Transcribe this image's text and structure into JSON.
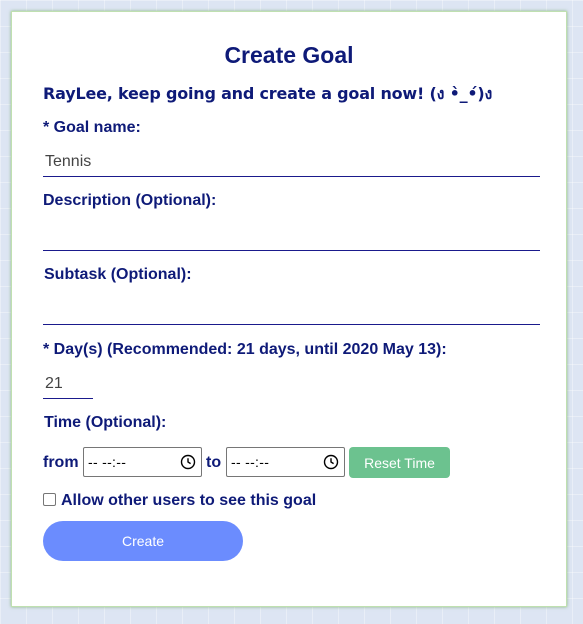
{
  "form": {
    "title": "Create Goal",
    "encouragement": "RayLee, keep going and create a goal now! (ง •̀_•́)ง",
    "goal_name_label": "* Goal name:",
    "goal_name_value": "Tennis",
    "description_label": "Description (Optional):",
    "description_value": "",
    "subtask_label": "Subtask (Optional):",
    "subtask_value": "",
    "days_label": "* Day(s) (Recommended: 21 days, until 2020 May 13):",
    "days_value": "21",
    "time_label": "Time (Optional):",
    "from_label": "from",
    "from_time_value": "-- --:--",
    "to_label": "to",
    "to_time_value": "-- --:--",
    "reset_time_label": "Reset Time",
    "share_checkbox_label": "Allow other users to see this goal",
    "share_checked": false,
    "create_label": "Create"
  },
  "colors": {
    "label_text": "#0e1a78",
    "reset_button": "#6cc28f",
    "create_button": "#6b8cfe",
    "card_border": "#bfe0b0"
  },
  "icons": {
    "time_picker": "clock-icon"
  }
}
